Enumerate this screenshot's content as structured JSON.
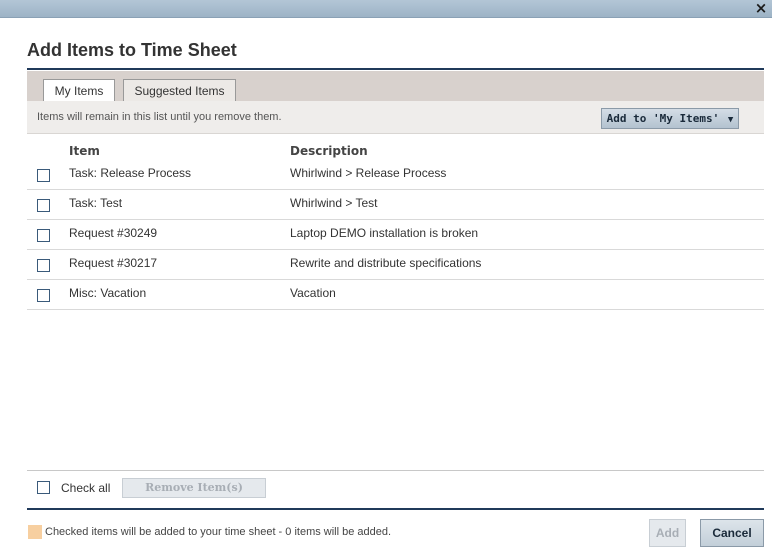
{
  "window": {
    "close_glyph": "×"
  },
  "dialog": {
    "title": "Add Items to Time Sheet"
  },
  "tabs": [
    {
      "label": "My Items",
      "active": true
    },
    {
      "label": "Suggested Items",
      "active": false
    }
  ],
  "info": {
    "text": "Items will remain in this list until you remove them.",
    "add_button_label": "Add to 'My Items'",
    "add_button_caret": "▼"
  },
  "table": {
    "columns": [
      "Item",
      "Description"
    ],
    "rows": [
      {
        "item": "Task: Release Process",
        "description": "Whirlwind > Release Process",
        "checked": false
      },
      {
        "item": "Task: Test",
        "description": "Whirlwind > Test",
        "checked": false
      },
      {
        "item": "Request #30249",
        "description": "Laptop DEMO installation is broken",
        "checked": false
      },
      {
        "item": "Request #30217",
        "description": "Rewrite and distribute specifications",
        "checked": false
      },
      {
        "item": "Misc: Vacation",
        "description": "Vacation",
        "checked": false
      }
    ]
  },
  "bulk": {
    "check_all_label": "Check all",
    "remove_label": "Remove Item(s)"
  },
  "footer": {
    "legend_text": "Checked items will be added to your time sheet - 0 items will be added.",
    "legend_color": "#f7cfa0",
    "add_label": "Add",
    "cancel_label": "Cancel"
  },
  "colors": {
    "accent": "#203a5a",
    "tabbar": "#d8d1cd"
  }
}
